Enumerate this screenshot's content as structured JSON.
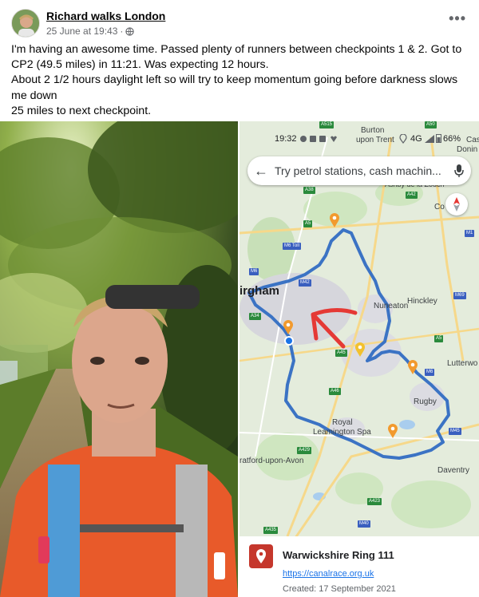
{
  "post": {
    "author": "Richard walks London",
    "date": "25 June at 19:43",
    "dot": "·",
    "privacy_icon": "globe-icon",
    "more_label": "•••",
    "text_lines": [
      "I'm having an awesome time. Passed plenty of runners between checkpoints 1 & 2. Got to CP2 (49.5 miles) in 11:21. Was expecting 12 hours.",
      "About 2 1/2 hours daylight left so will try to keep momentum going before darkness slows me down",
      "25 miles to next checkpoint."
    ]
  },
  "phone": {
    "time": "19:32",
    "network": "4G",
    "battery": "66%",
    "search_placeholder": "Try petrol stations, cash machin...",
    "icons": [
      "settings-icon",
      "message-icon",
      "whatsapp-icon",
      "heart-icon",
      "location-icon",
      "signal-icon",
      "battery-icon"
    ]
  },
  "map": {
    "labels": {
      "burton": "Burton",
      "upon_trent": "upon Trent",
      "cast": "Cast",
      "donin": "Donin",
      "ashby": "Ashby de la Zouch",
      "co": "Co",
      "birmingham": "irgham",
      "nuneaton": "Nuneaton",
      "hinckley": "Hinckley",
      "lutterworth": "Lutterwo",
      "rugby": "Rugby",
      "royal": "Royal",
      "leamington": "Leamington Spa",
      "stratford": "ratford-upon-Avon",
      "daventry": "Daventry"
    },
    "shields": {
      "a515": "A515",
      "a50": "A50",
      "a38": "A38",
      "a42": "A42",
      "a5": "A5",
      "m6toll": "M6 Toll",
      "m1": "M1",
      "m6": "M6",
      "m42": "M42",
      "m69": "M69",
      "a34": "A34",
      "a45": "A45",
      "m45": "M45",
      "a46": "A46",
      "a429": "A429",
      "a423": "A423",
      "m40": "M40",
      "a435": "A435",
      "a5b": "A5",
      "m6b": "M6"
    }
  },
  "place": {
    "title": "Warwickshire Ring 111",
    "link": "https://canalrace.org.uk",
    "created": "Created: 17 September 2021"
  },
  "colors": {
    "route": "#3b73c4",
    "pin": "#f29a2e",
    "arrow": "#e53935",
    "place_icon": "#c5372c"
  }
}
